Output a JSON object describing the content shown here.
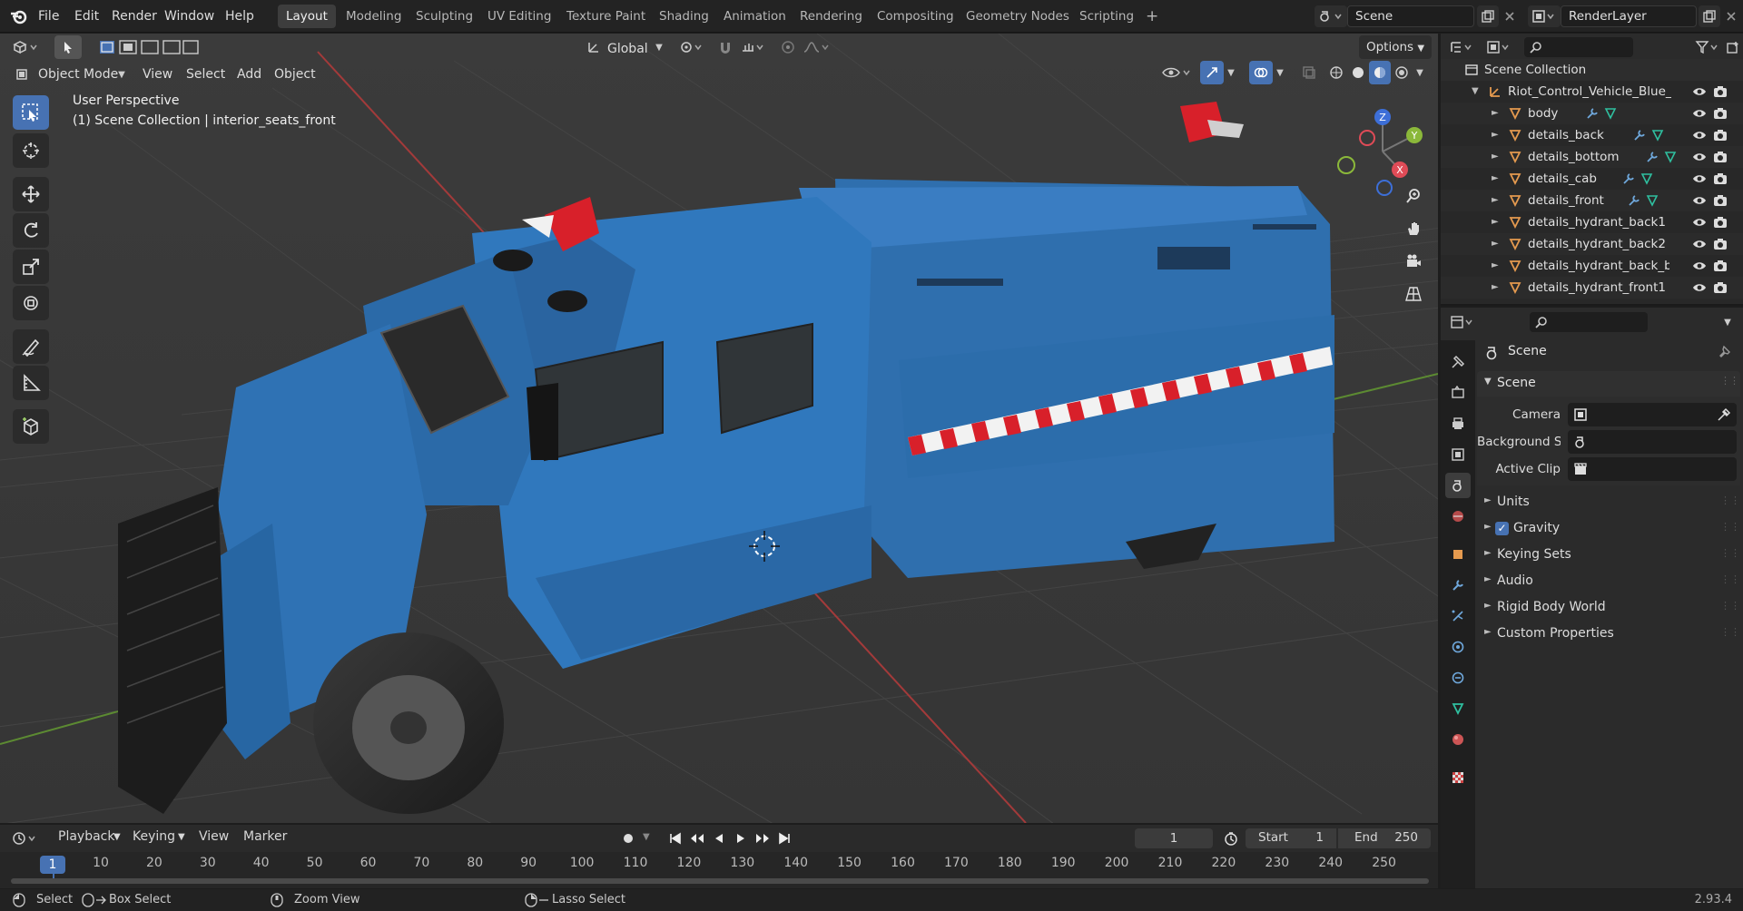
{
  "topbar": {
    "menus": [
      "File",
      "Edit",
      "Render",
      "Window",
      "Help"
    ],
    "workspaces": [
      "Layout",
      "Modeling",
      "Sculpting",
      "UV Editing",
      "Texture Paint",
      "Shading",
      "Animation",
      "Rendering",
      "Compositing",
      "Geometry Nodes",
      "Scripting"
    ],
    "active_workspace": "Layout",
    "add_workspace": "+",
    "scene_name": "Scene",
    "view_layer": "RenderLayer"
  },
  "viewport_header": {
    "transform_orientation": "Global",
    "options_label": "Options",
    "mode": "Object Mode",
    "menus": [
      "View",
      "Select",
      "Add",
      "Object"
    ]
  },
  "viewport": {
    "perspective_label": "User Perspective",
    "context_label": "(1) Scene Collection | interior_seats_front",
    "gizmo_axes": {
      "x": "X",
      "y": "Y",
      "z": "Z"
    }
  },
  "outliner": {
    "root": "Scene Collection",
    "collection": "Riot_Control_Vehicle_Blue_Si",
    "objects": [
      "body",
      "details_back",
      "details_bottom",
      "details_cab",
      "details_front",
      "details_hydrant_back1",
      "details_hydrant_back2",
      "details_hydrant_back_ba",
      "details_hydrant_front1"
    ]
  },
  "properties": {
    "context_title": "Scene",
    "panel_title": "Scene",
    "fields": [
      {
        "label": "Camera",
        "value": ""
      },
      {
        "label": "Background Sce...",
        "value": ""
      },
      {
        "label": "Active Clip",
        "value": ""
      }
    ],
    "sections": [
      {
        "label": "Units",
        "checkbox": false
      },
      {
        "label": "Gravity",
        "checkbox": true,
        "checked": true
      },
      {
        "label": "Keying Sets",
        "checkbox": false
      },
      {
        "label": "Audio",
        "checkbox": false
      },
      {
        "label": "Rigid Body World",
        "checkbox": false
      },
      {
        "label": "Custom Properties",
        "checkbox": false
      }
    ]
  },
  "timeline": {
    "menus": [
      "Playback",
      "Keying",
      "View",
      "Marker"
    ],
    "current_frame": "1",
    "start_label": "Start",
    "start_value": "1",
    "end_label": "End",
    "end_value": "250",
    "ticks": [
      "1",
      "10",
      "20",
      "30",
      "40",
      "50",
      "60",
      "70",
      "80",
      "90",
      "100",
      "110",
      "120",
      "130",
      "140",
      "150",
      "160",
      "170",
      "180",
      "190",
      "200",
      "210",
      "220",
      "230",
      "240",
      "250"
    ]
  },
  "statusbar": {
    "hints": [
      "Select",
      "Box Select",
      "Zoom View",
      "Lasso Select"
    ],
    "version": "2.93.4"
  },
  "colors": {
    "accent": "#4772b3",
    "vehicle_blue": "#2f74b8",
    "stripe_red": "#d8202a",
    "object_icon": "#e59a4f",
    "modifier_icon": "#6fa8dc",
    "mesh_icon": "#2fc0a0"
  }
}
